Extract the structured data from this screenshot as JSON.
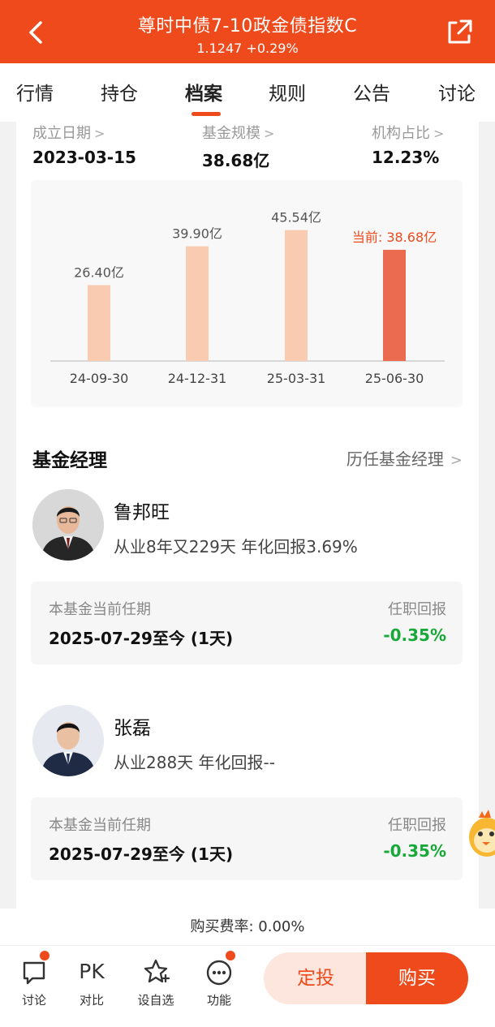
{
  "header": {
    "title": "尊时中债7-10政金债指数C",
    "subtitle": "1.1247 +0.29%"
  },
  "tabs": [
    "行情",
    "持仓",
    "档案",
    "规则",
    "公告",
    "讨论"
  ],
  "active_tab": "档案",
  "info": {
    "establish_label": "成立日期",
    "establish_value": "2023-03-15",
    "scale_label": "基金规模",
    "scale_value": "38.68亿",
    "inst_label": "机构占比",
    "inst_value": "12.23%"
  },
  "chart_data": {
    "type": "bar",
    "categories": [
      "24-09-30",
      "24-12-31",
      "25-03-31",
      "25-06-30"
    ],
    "values": [
      26.4,
      39.9,
      45.54,
      38.68
    ],
    "labels": [
      "26.40亿",
      "39.90亿",
      "45.54亿",
      "当前: 38.68亿"
    ],
    "unit": "亿",
    "ylim": [
      0,
      50
    ],
    "colors": {
      "normal": "#f9ccb2",
      "current": "#ea6b50",
      "current_label": "#ef4a1c"
    }
  },
  "managers_section": {
    "title": "基金经理",
    "history_link": "历任基金经理"
  },
  "managers": [
    {
      "name": "鲁邦旺",
      "desc": "从业8年又229天 年化回报3.69%",
      "tenure_label": "本基金当前任期",
      "tenure_value": "2025-07-29至今 (1天)",
      "return_label": "任职回报",
      "return_value": "-0.35%"
    },
    {
      "name": "张磊",
      "desc": "从业288天 年化回报--",
      "tenure_label": "本基金当前任期",
      "tenure_value": "2025-07-29至今 (1天)",
      "return_label": "任职回报",
      "return_value": "-0.35%"
    }
  ],
  "fee": "购买费率: 0.00%",
  "bottom": {
    "discuss": "讨论",
    "pk_icon": "PK",
    "compare": "对比",
    "watch": "设自选",
    "func": "功能",
    "ding": "定投",
    "buy": "购买"
  },
  "colors": {
    "brand": "#ef4a1c",
    "green": "#18a83a"
  }
}
